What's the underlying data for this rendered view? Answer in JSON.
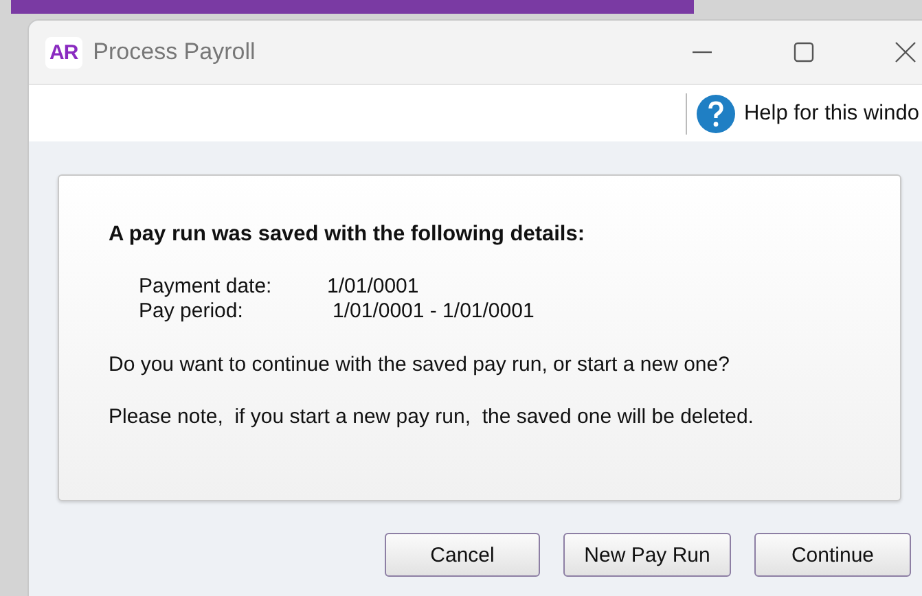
{
  "window": {
    "logo": "AR",
    "title": "Process Payroll"
  },
  "toolbar": {
    "help": "Help for this windo"
  },
  "message": {
    "heading": "A pay run was saved with the following details:",
    "details": [
      {
        "label": "Payment date:",
        "value": "1/01/0001"
      },
      {
        "label": "Pay period:",
        "value": "1/01/0001 - 1/01/0001"
      }
    ],
    "question": "Do you want to continue with the saved pay run, or start a new one?",
    "note": "Please note,  if you start a new pay run,  the saved one will be deleted."
  },
  "buttons": [
    "Cancel",
    "New Pay Run",
    "Continue"
  ]
}
